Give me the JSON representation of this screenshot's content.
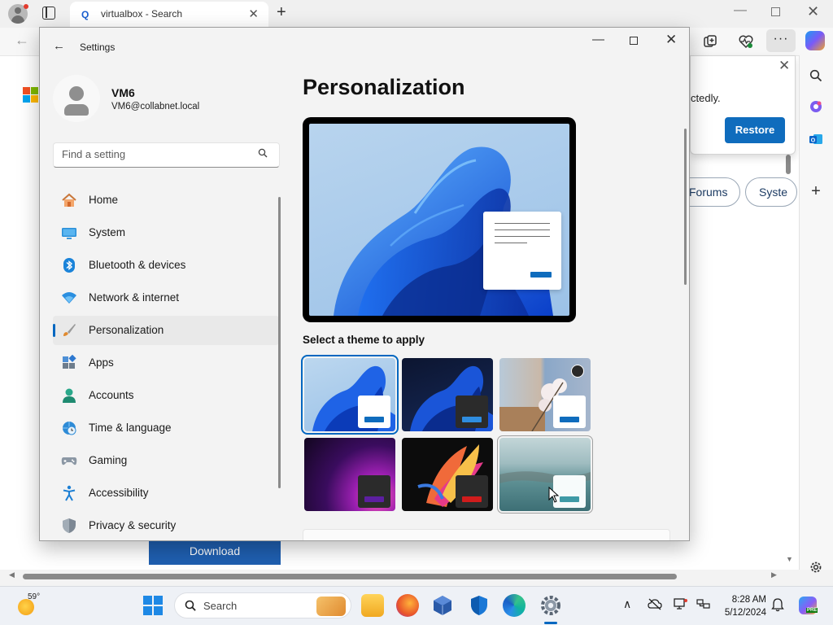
{
  "browser": {
    "tab_title": "virtualbox - Search",
    "new_tab_symbol": "+",
    "more_symbol": "···"
  },
  "page": {
    "popup_text": "ctedly.",
    "restore_label": "Restore",
    "pill_forums": "Forums",
    "pill_system": "Syste",
    "download_label": "Download"
  },
  "settings": {
    "window_title": "Settings",
    "user": {
      "name": "VM6",
      "email": "VM6@collabnet.local"
    },
    "search_placeholder": "Find a setting",
    "nav": [
      {
        "label": "Home",
        "icon": "home-icon"
      },
      {
        "label": "System",
        "icon": "system-icon"
      },
      {
        "label": "Bluetooth & devices",
        "icon": "bluetooth-icon"
      },
      {
        "label": "Network & internet",
        "icon": "wifi-icon"
      },
      {
        "label": "Personalization",
        "icon": "brush-icon",
        "active": true
      },
      {
        "label": "Apps",
        "icon": "apps-icon"
      },
      {
        "label": "Accounts",
        "icon": "accounts-icon"
      },
      {
        "label": "Time & language",
        "icon": "globe-clock-icon"
      },
      {
        "label": "Gaming",
        "icon": "gamepad-icon"
      },
      {
        "label": "Accessibility",
        "icon": "accessibility-icon"
      },
      {
        "label": "Privacy & security",
        "icon": "shield-icon"
      }
    ],
    "content_title": "Personalization",
    "theme_heading": "Select a theme to apply",
    "themes": [
      {
        "name": "windows-light",
        "selected": true
      },
      {
        "name": "windows-dark"
      },
      {
        "name": "flowers"
      },
      {
        "name": "glow"
      },
      {
        "name": "captured-motion"
      },
      {
        "name": "flow"
      }
    ]
  },
  "taskbar": {
    "weather_temp": "59°",
    "search_label": "Search",
    "time": "8:28 AM",
    "date": "5/12/2024",
    "pre_badge": "PRE"
  },
  "colors": {
    "accent": "#0067c0",
    "restore_button": "#0f6cbd",
    "download_button": "#1f5fb0"
  }
}
